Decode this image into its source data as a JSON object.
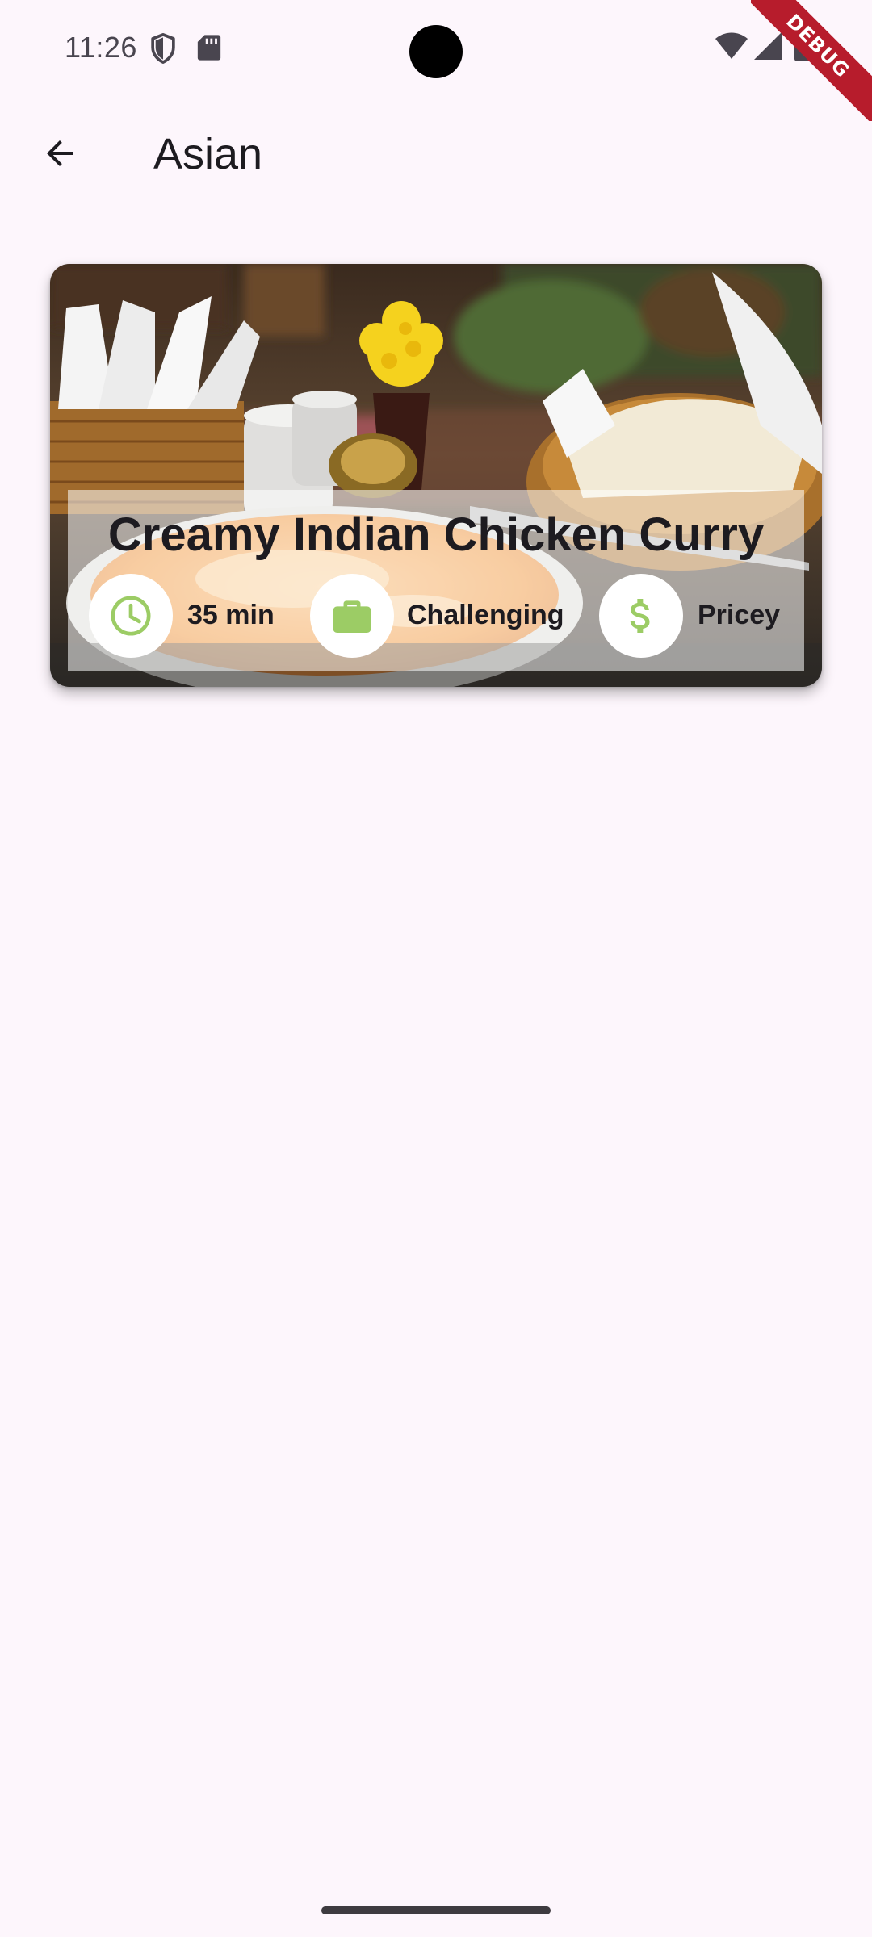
{
  "status_bar": {
    "time": "11:26",
    "icons": [
      "shield-icon",
      "sd-card-icon",
      "wifi-icon",
      "signal-icon",
      "battery-icon"
    ],
    "debug_label": "DEBUG"
  },
  "app_bar": {
    "back_icon": "arrow-back-icon",
    "title": "Asian"
  },
  "meals": [
    {
      "title": "Creamy Indian Chicken Curry",
      "duration": "35 min",
      "complexity": "Challenging",
      "affordability": "Pricey",
      "icons": {
        "duration": "clock-icon",
        "complexity": "briefcase-icon",
        "affordability": "dollar-icon"
      }
    }
  ],
  "colors": {
    "background": "#fdf6fc",
    "accent_icon": "#9ccc65",
    "debug_banner": "#b71c2c",
    "text": "#1d1b20"
  }
}
